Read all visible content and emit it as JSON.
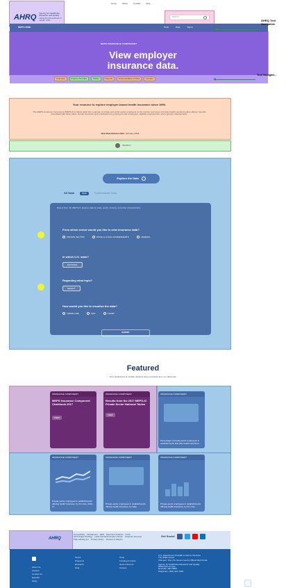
{
  "top": {
    "logo_text": "AHRQ",
    "logo_subtext_line1": "Agency for Healthcare Research and Quality",
    "logo_subtext_line2": "Advancing Excellence in Health Care",
    "top_links": [
      "Home",
      "About",
      "Contact",
      "Help"
    ],
    "search_placeholder": "Search",
    "nav_left": "MEPS HOME",
    "nav_items": [
      "Tools",
      "Data",
      "Topics"
    ]
  },
  "hero": {
    "badge": "MEPS INSURANCE COMPONENT",
    "title_line1": "View employer",
    "title_line2": "insurance data."
  },
  "tool_nav": {
    "items": [
      "Overview",
      "Explore the Data",
      "Tables",
      "Reports",
      "Documentation & Files",
      "Contact"
    ]
  },
  "intro": {
    "title": "Your resource to explore employer-based health insurance since 1996.",
    "body": "The MEPS Insurance Component (MEPS-IC) collects data from a sample of private and public sector employers on the number and types of private health insurance plans offered, benefits associated with these plans, annual premiums and contributions by employers and employees, eligibility requirements, and employer characteristics.",
    "release_label": "Next Data Release Date:",
    "release_date": "February 2018"
  },
  "search_bar": {
    "label": "SEARCH"
  },
  "explore": {
    "button": "Explore the Data",
    "tabs": [
      "All Data",
      "Summarized Data"
    ],
    "tab_badge": "NEW",
    "note": "Data is from the MEPS-IC. Explore data by state, sector, industry, and other characteristics.",
    "q1_title": "From which sector would you like to view insurance data?",
    "q1_opts": [
      "PRIVATE SECTOR",
      "STATE & LOCAL GOVERNMENTS",
      "FEDERAL"
    ],
    "q2_title": "In which U.S. state?",
    "q2_value": "NATIONAL",
    "q3_title": "Regarding what topic?",
    "q3_value": "SELECT",
    "q4_title": "How would you like to visualize the data?",
    "q4_opts": [
      "TREND LINE",
      "MAP",
      "CHART"
    ],
    "submit": "SUBMIT"
  },
  "featured": {
    "title": "Featured",
    "subtitle": "View publications & visually featured query examples from our data tools.",
    "cards": [
      {
        "kind": "pub",
        "header": "INSURANCE COMPONENT",
        "title": "MEPS Insurance Component Chartbook 2017",
        "cta": "VIEW"
      },
      {
        "kind": "pub",
        "header": "INSURANCE COMPONENT",
        "title": "Results from the 2017 MEPS-IC Private Sector National Tables",
        "cta": "VIEW"
      },
      {
        "kind": "map",
        "header": "INSURANCE COMPONENT",
        "title": "Percentage of private-sector employees in establishments that offer health insurance..."
      },
      {
        "kind": "line",
        "header": "INSURANCE COMPONENT",
        "title": "Private-sector employees in establishments offering health insurance, by firm size, 2016–17"
      },
      {
        "kind": "map2",
        "header": "INSURANCE COMPONENT",
        "title": "Private-sector employees in establishments offering health insurance, by state"
      },
      {
        "kind": "bars",
        "header": "INSURANCE COMPONENT",
        "title": "Private-sector employees in establishments offering health insurance, by firm size"
      }
    ]
  },
  "footer": {
    "logo": "AHRQ",
    "links_1": [
      "Accessibility",
      "Disclaimers",
      "EEO",
      "Electronic Policies",
      "FOIA"
    ],
    "links_2": [
      "HHS Digital Strategy",
      "HHS Nondiscrimination Notice",
      "Inspector General"
    ],
    "links_3": [
      "Plain Writing Act",
      "Privacy Policy",
      "Viewers & Players"
    ],
    "social_label": "Get Social",
    "social": [
      "facebook",
      "twitter",
      "youtube",
      "linkedin"
    ],
    "bottom_col1": [
      "About Us",
      "Careers",
      "Contact Us",
      "Español",
      "FAQs"
    ],
    "bottom_col2": [
      "Topics",
      "Programs",
      "Research",
      "Data"
    ],
    "bottom_col3": [
      "Tools",
      "Funding & Grants",
      "News & Events",
      "Careers"
    ],
    "agency_line1": "U.S. Department of Health & Human Services",
    "agency_line2": "The White House",
    "agency_line3": "USA.gov: The U.S. Government's Official Web Portal",
    "address_line1": "Agency for Healthcare Research and Quality",
    "address_line2": "5600 Fishers Lane",
    "address_line3": "Rockville, MD 20857",
    "address_line4": "Telephone: (301) 427-1364"
  },
  "annotations": {
    "top": "AHRQ Tool Navigation",
    "tool": "Tool Navigati..."
  },
  "colors": {
    "hero_purple": "#7b5bd6",
    "explore_bg": "#4b77b7",
    "panel_bg": "#4a6ea6",
    "featured_pink": "#f3a8d5",
    "featured_blue": "#b8d6f0",
    "footer_blue": "#1d5fa7"
  }
}
